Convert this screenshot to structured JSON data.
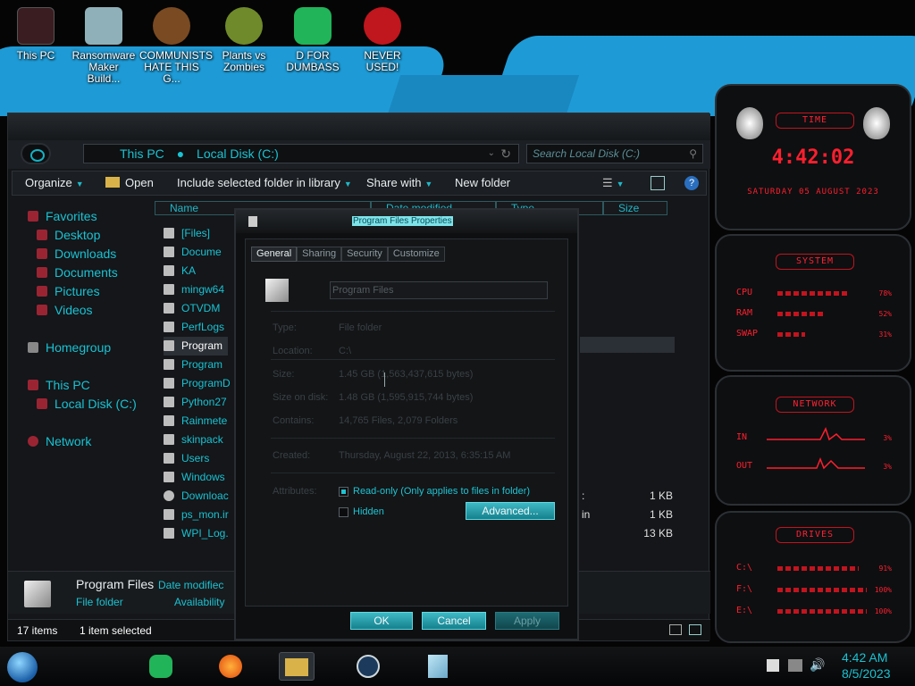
{
  "desktop": {
    "icons": [
      {
        "label": "This PC",
        "color": "#3a1d21"
      },
      {
        "label": "Ransomware Maker Build...",
        "color": "#8fb0b8"
      },
      {
        "label": "COMMUNISTS HATE THIS G...",
        "color": "#7a4a22"
      },
      {
        "label": "Plants vs Zombies",
        "color": "#6f8a2a"
      },
      {
        "label": "D FOR DUMBASS",
        "color": "#21b459"
      },
      {
        "label": "NEVER USED!",
        "color": "#c0161e"
      }
    ]
  },
  "explorer": {
    "breadcrumb": [
      "This PC",
      "Local Disk (C:)"
    ],
    "search_placeholder": "Search Local Disk (C:)",
    "commands": {
      "organize": "Organize",
      "open": "Open",
      "include": "Include selected folder in library",
      "share": "Share with",
      "new_folder": "New folder"
    },
    "nav": {
      "favorites": "Favorites",
      "favorites_items": [
        "Desktop",
        "Downloads",
        "Documents",
        "Pictures",
        "Videos"
      ],
      "homegroup": "Homegroup",
      "this_pc": "This PC",
      "local_disk": "Local Disk (C:)",
      "network": "Network"
    },
    "columns": {
      "name": "Name",
      "date": "Date modified",
      "type": "Type",
      "size": "Size"
    },
    "files": [
      "[Files]",
      "Docume",
      "KA",
      "mingw64",
      "OTVDM",
      "PerfLogs",
      "Program",
      "Program",
      "ProgramD",
      "Python27",
      "Rainmete",
      "skinpack",
      "Users",
      "Windows",
      "Downloac",
      "ps_mon.ir",
      "WPI_Log."
    ],
    "selected_index": 6,
    "type_fragments": [
      ":",
      "in"
    ],
    "sizes": [
      "1 KB",
      "1 KB",
      "13 KB"
    ],
    "details": {
      "name": "Program Files",
      "date_label": "Date modifiec",
      "type": "File folder",
      "availability_label": "Availability"
    },
    "status": {
      "items": "17 items",
      "selected": "1 item selected"
    }
  },
  "dialog": {
    "title": "Program Files Properties",
    "tabs": [
      "General",
      "Sharing",
      "Security",
      "Customize"
    ],
    "name_value": "Program Files",
    "type_label": "Type:",
    "type_value": "File folder",
    "location_label": "Location:",
    "location_value": "C:\\",
    "size_label": "Size:",
    "size_value": "1.45 GB (1,563,437,615 bytes)",
    "size_on_disk_label": "Size on disk:",
    "size_on_disk_value": "1.48 GB (1,595,915,744 bytes)",
    "contains_label": "Contains:",
    "contains_value": "14,765 Files, 2,079 Folders",
    "created_label": "Created:",
    "created_value": "Thursday, August 22, 2013, 6:35:15 AM",
    "attributes_label": "Attributes:",
    "readonly_label": "Read-only (Only applies to files in folder)",
    "readonly_checked": true,
    "hidden_label": "Hidden",
    "hidden_checked": false,
    "advanced_label": "Advanced...",
    "ok_label": "OK",
    "cancel_label": "Cancel",
    "apply_label": "Apply"
  },
  "gadgets": {
    "time_header": "TIME",
    "time": "4:42:02",
    "date": "saturday 05 august 2023",
    "system_header": "SYSTEM",
    "cpu_label": "CPU",
    "cpu_value": "78%",
    "cpu_percent": 78,
    "ram_label": "RAM",
    "ram_value": "52%",
    "ram_percent": 52,
    "swap_label": "SWAP",
    "swap_value": "31%",
    "swap_percent": 31,
    "network_header": "NETWORK",
    "in_label": "IN",
    "in_value": "3%",
    "out_label": "OUT",
    "out_value": "3%",
    "drives_header": "DRIVES",
    "drives": [
      {
        "label": "C:\\",
        "value": "91%",
        "percent": 91
      },
      {
        "label": "F:\\",
        "value": "100%",
        "percent": 100
      },
      {
        "label": "E:\\",
        "value": "100%",
        "percent": 100
      }
    ]
  },
  "taskbar": {
    "apps": [
      "spotify",
      "firefox",
      "file-explorer",
      "steam",
      "notepad"
    ],
    "clock_time": "4:42 AM",
    "clock_date": "8/5/2023"
  },
  "colors": {
    "accent": "#19c3d2",
    "gadget_red": "#ff1f2e",
    "banner_blue": "#1e9bd6"
  }
}
